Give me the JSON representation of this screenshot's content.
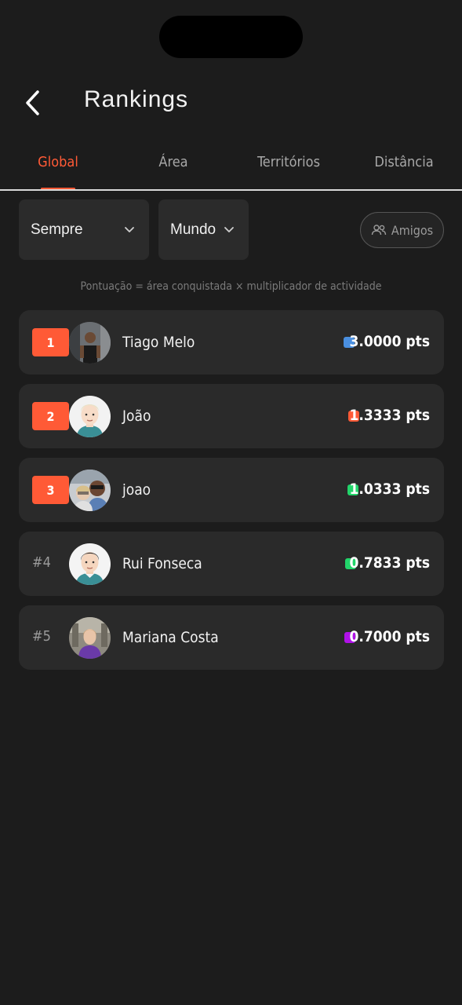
{
  "header": {
    "title": "Rankings"
  },
  "tabs": [
    {
      "label": "Global",
      "active": true
    },
    {
      "label": "Área",
      "active": false
    },
    {
      "label": "Territórios",
      "active": false
    },
    {
      "label": "Distância",
      "active": false
    }
  ],
  "filters": {
    "period": {
      "value": "Sempre"
    },
    "region": {
      "value": "Mundo"
    },
    "friends_label": "Amigos"
  },
  "hint": "Pontuação = área conquistada × multiplicador de actividade",
  "ranking": [
    {
      "rank": "1",
      "name": "Tiago Melo",
      "points": "3.0000 pts",
      "color": "#4a8fe0"
    },
    {
      "rank": "2",
      "name": "João",
      "points": "1.3333 pts",
      "color": "#ff5a36"
    },
    {
      "rank": "3",
      "name": "joao",
      "points": "1.0333 pts",
      "color": "#22d46a"
    },
    {
      "rank": "#4",
      "name": "Rui Fonseca",
      "points": "0.7833 pts",
      "color": "#22d46a"
    },
    {
      "rank": "#5",
      "name": "Mariana Costa",
      "points": "0.7000 pts",
      "color": "#b012e8"
    }
  ],
  "colors": {
    "accent": "#ff5a36",
    "background": "#1c1c1c",
    "card": "#2a2a2a"
  }
}
